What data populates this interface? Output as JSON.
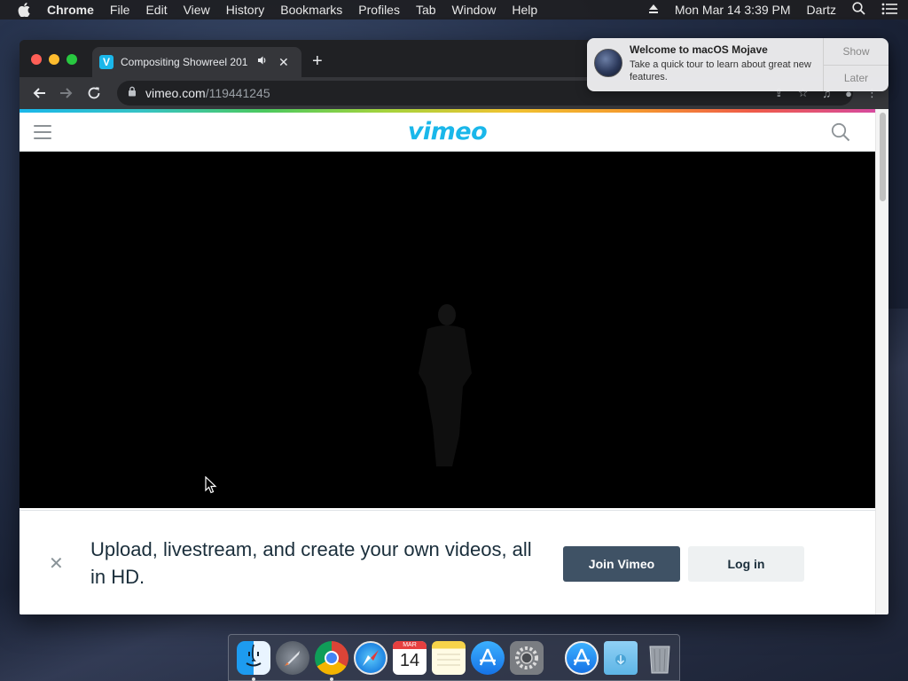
{
  "menubar": {
    "app_name": "Chrome",
    "items": [
      "File",
      "Edit",
      "View",
      "History",
      "Bookmarks",
      "Profiles",
      "Tab",
      "Window",
      "Help"
    ],
    "clock": "Mon Mar 14  3:39 PM",
    "user": "Dartz"
  },
  "notification": {
    "title": "Welcome to macOS Mojave",
    "text": "Take a quick tour to learn about great new features.",
    "show_label": "Show",
    "later_label": "Later"
  },
  "browser": {
    "tab_title": "Compositing Showreel 201",
    "favicon_letter": "V",
    "url_domain": "vimeo.com",
    "url_path": "/119441245"
  },
  "page": {
    "logo_text": "vimeo",
    "banner_text": "Upload, livestream, and create your own videos, all in HD.",
    "join_label": "Join Vimeo",
    "login_label": "Log in"
  },
  "dock": {
    "calendar_month": "MAR",
    "calendar_day": "14",
    "items": [
      "finder-icon",
      "launchpad-icon",
      "chrome-icon",
      "safari-icon",
      "calendar-icon",
      "notes-icon",
      "app-store-icon",
      "system-preferences-icon",
      "app-store-download-icon",
      "downloads-folder-icon",
      "trash-icon"
    ]
  },
  "colors": {
    "vimeo_blue": "#1ab7ea",
    "join_button": "#3f5265",
    "login_button": "#eef1f2"
  }
}
